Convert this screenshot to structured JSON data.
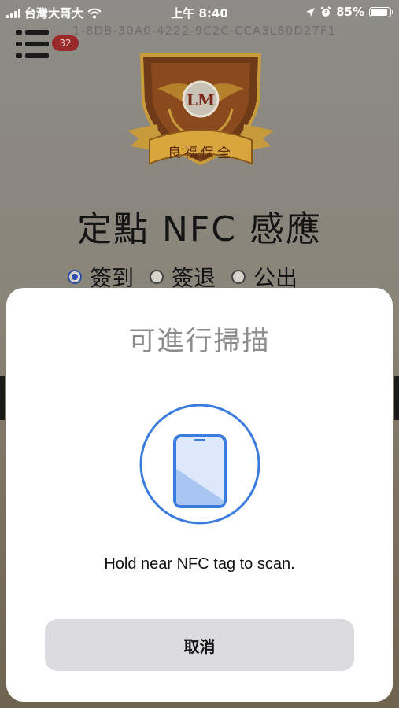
{
  "status_bar": {
    "carrier": "台灣大哥大",
    "time": "上午 8:40",
    "battery": "85%",
    "battery_level": 0.85,
    "icons": [
      "signal-icon",
      "wifi-icon",
      "location-icon",
      "alarm-icon",
      "battery-icon"
    ]
  },
  "header": {
    "menu_badge": "32",
    "device_id": "1-8DB-30A0-4222-9C2C-CCA3L80D27F1"
  },
  "logo": {
    "text": "良福保全",
    "monogram": "LM"
  },
  "page": {
    "title": "定點 NFC 感應",
    "options": [
      {
        "label": "簽到",
        "selected": true
      },
      {
        "label": "簽退",
        "selected": false
      },
      {
        "label": "公出",
        "selected": false
      }
    ]
  },
  "nfc_sheet": {
    "title": "可進行掃描",
    "instruction": "Hold near NFC tag to scan.",
    "cancel_label": "取消",
    "accent_color": "#3a7be0"
  }
}
